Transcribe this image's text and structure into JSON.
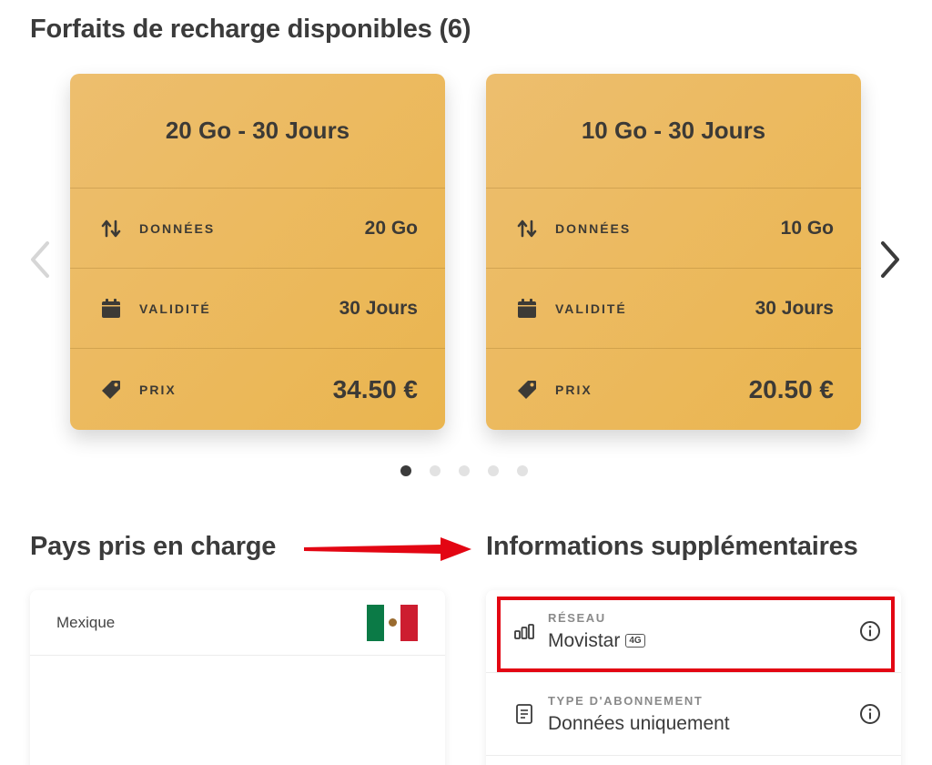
{
  "header": {
    "title": "Forfaits de recharge disponibles (6)"
  },
  "plans": [
    {
      "title": "20 Go - 30 Jours",
      "rows": [
        {
          "icon": "data-transfer-icon",
          "label": "DONNÉES",
          "value": "20 Go"
        },
        {
          "icon": "calendar-icon",
          "label": "VALIDITÉ",
          "value": "30 Jours"
        },
        {
          "icon": "price-tag-icon",
          "label": "PRIX",
          "value": "34.50 €"
        }
      ]
    },
    {
      "title": "10 Go - 30 Jours",
      "rows": [
        {
          "icon": "data-transfer-icon",
          "label": "DONNÉES",
          "value": "10 Go"
        },
        {
          "icon": "calendar-icon",
          "label": "VALIDITÉ",
          "value": "30 Jours"
        },
        {
          "icon": "price-tag-icon",
          "label": "PRIX",
          "value": "20.50 €"
        }
      ]
    }
  ],
  "carousel": {
    "total_pages": 5,
    "active_page": 1
  },
  "countries": {
    "title": "Pays pris en charge",
    "items": [
      {
        "name": "Mexique",
        "flag": "mexico-flag-icon"
      }
    ]
  },
  "additional_info": {
    "title": "Informations supplémentaires",
    "rows": [
      {
        "icon": "signal-bars-icon",
        "label": "RÉSEAU",
        "value": "Movistar",
        "badge": "4G"
      },
      {
        "icon": "document-icon",
        "label": "TYPE D'ABONNEMENT",
        "value": "Données uniquement"
      }
    ]
  },
  "colors": {
    "card_gradient_start": "#edbe6e",
    "card_gradient_end": "#eab54f",
    "highlight": "#e30613",
    "text_dark": "#3b3b3b"
  }
}
